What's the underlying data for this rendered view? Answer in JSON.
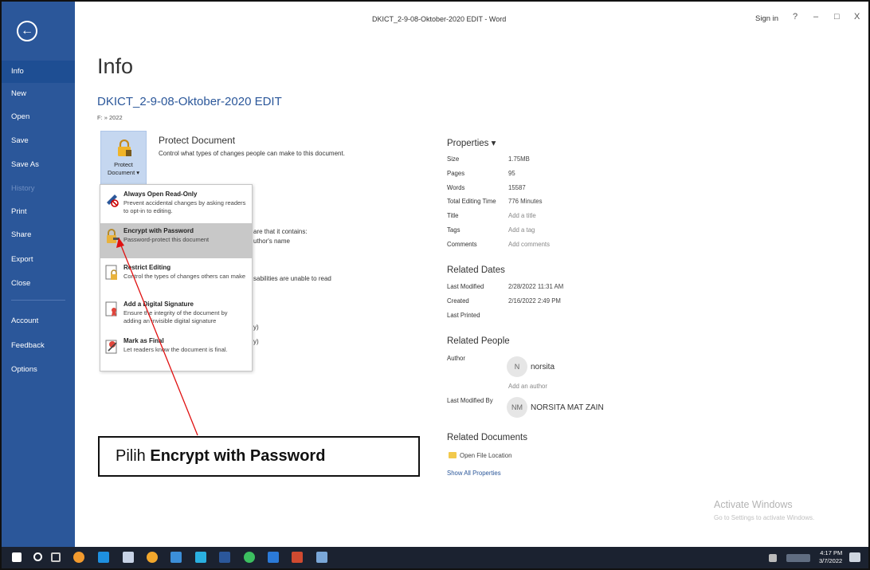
{
  "window": {
    "title": "DKICT_2-9-08-Oktober-2020 EDIT - Word",
    "sign_in": "Sign in",
    "help": "?",
    "minimize": "–",
    "restore": "□",
    "close": "X"
  },
  "sidebar": {
    "back": "←",
    "items": [
      {
        "label": "Info"
      },
      {
        "label": "New"
      },
      {
        "label": "Open"
      },
      {
        "label": "Save"
      },
      {
        "label": "Save As"
      },
      {
        "label": "History"
      },
      {
        "label": "Print"
      },
      {
        "label": "Share"
      },
      {
        "label": "Export"
      },
      {
        "label": "Close"
      },
      {
        "label": "Account"
      },
      {
        "label": "Feedback"
      },
      {
        "label": "Options"
      }
    ]
  },
  "main": {
    "title": "Info",
    "doc_name": "DKICT_2-9-08-Oktober-2020 EDIT",
    "doc_path": "F: » 2022",
    "protect": {
      "tile_line1": "Protect",
      "tile_line2": "Document ▾",
      "heading": "Protect Document",
      "description": "Control what types of changes people can make to this document."
    },
    "partial": {
      "contains": "are that it contains:",
      "author_name": "uthor's name",
      "disabilities": "sabilities are unable to read",
      "y1": "y)",
      "y2": "y)"
    }
  },
  "menu": {
    "items": [
      {
        "title": "Always Open Read-Only",
        "desc": "Prevent accidental changes by asking readers to opt-in to editing."
      },
      {
        "title": "Encrypt with Password",
        "desc": "Password-protect this document"
      },
      {
        "title": "Restrict Editing",
        "desc": "Control the types of changes others can make"
      },
      {
        "title": "Add a Digital Signature",
        "desc": "Ensure the integrity of the document by adding an invisible digital signature"
      },
      {
        "title": "Mark as Final",
        "desc": "Let readers know the document is final."
      }
    ]
  },
  "properties": {
    "heading": "Properties ▾",
    "rows": [
      {
        "k": "Size",
        "v": "1.75MB"
      },
      {
        "k": "Pages",
        "v": "95"
      },
      {
        "k": "Words",
        "v": "15587"
      },
      {
        "k": "Total Editing Time",
        "v": "776 Minutes"
      },
      {
        "k": "Title",
        "v": "Add a title"
      },
      {
        "k": "Tags",
        "v": "Add a tag"
      },
      {
        "k": "Comments",
        "v": "Add comments"
      }
    ],
    "dates_heading": "Related Dates",
    "dates": [
      {
        "k": "Last Modified",
        "v": "2/28/2022 11:31 AM"
      },
      {
        "k": "Created",
        "v": "2/16/2022 2:49 PM"
      },
      {
        "k": "Last Printed",
        "v": ""
      }
    ],
    "people_heading": "Related People",
    "author_label": "Author",
    "author_initial": "N",
    "author_name": "norsita",
    "add_author": "Add an author",
    "last_modified_by_label": "Last Modified By",
    "modifier_initials": "NM",
    "modifier_name": "NORSITA MAT ZAIN",
    "docs_heading": "Related Documents",
    "open_file_location": "Open File Location",
    "show_all": "Show All Properties"
  },
  "watermark": {
    "line1": "Activate Windows",
    "line2": "Go to Settings to activate Windows."
  },
  "annotation": {
    "prefix": "Pilih ",
    "bold": "Encrypt with  Password"
  },
  "taskbar": {
    "time": "4:17 PM",
    "date": "3/7/2022"
  }
}
